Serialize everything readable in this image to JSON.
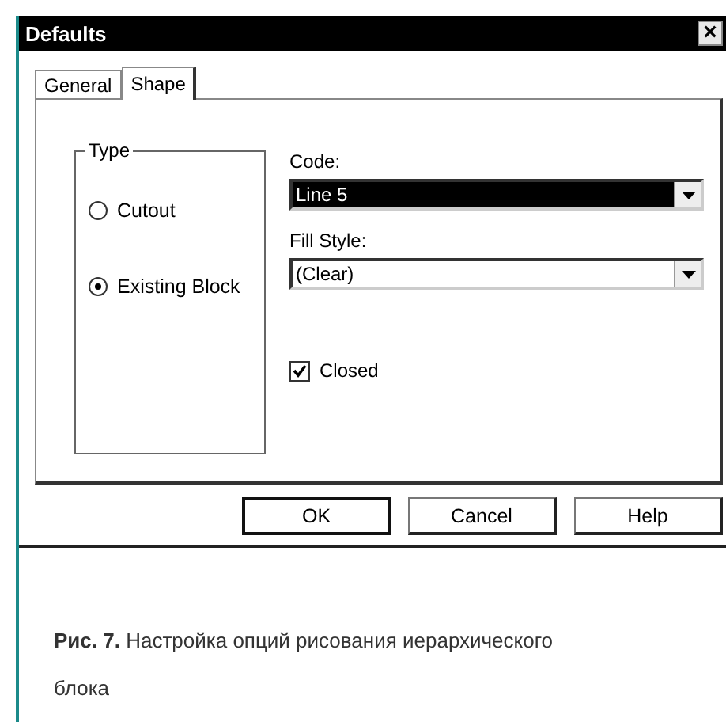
{
  "window": {
    "title": "Defaults",
    "close": "×"
  },
  "tabs": [
    {
      "label": "General",
      "selected": false
    },
    {
      "label": "Shape",
      "selected": true
    }
  ],
  "type_group": {
    "title": "Type",
    "options": [
      {
        "label": "Cutout",
        "selected": false
      },
      {
        "label": "Existing Block",
        "selected": true
      }
    ]
  },
  "code": {
    "label": "Code:",
    "value": "Line 5",
    "focused": true
  },
  "fill_style": {
    "label": "Fill Style:",
    "value": "(Clear)",
    "focused": false
  },
  "closed": {
    "label": "Closed",
    "checked": true
  },
  "buttons": [
    {
      "label": "OK",
      "default": true
    },
    {
      "label": "Cancel",
      "default": false
    },
    {
      "label": "Help",
      "default": false
    }
  ],
  "caption": "**Рис. 7.** Настройка опций рисования иерархического блока"
}
